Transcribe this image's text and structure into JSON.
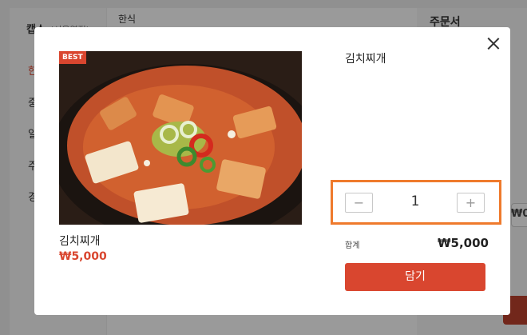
{
  "background": {
    "brand": "캡스",
    "brand_sub": "(서울역점)",
    "sidebar_items": [
      "한",
      "중",
      "일",
      "주",
      "경"
    ],
    "main_title": "한식",
    "order_title": "주문서",
    "order_amount_partial": "₩0"
  },
  "modal": {
    "badge": "BEST",
    "photo_label": "kimchi-stew-photo",
    "item_name": "김치찌개",
    "item_price": "₩5,000",
    "detail_name": "김치찌개",
    "quantity": {
      "minus": "−",
      "value": "1",
      "plus": "+"
    },
    "total_label": "합계",
    "total_value": "₩5,000",
    "add_button": "담기",
    "close_icon": "close-icon"
  },
  "colors": {
    "accent": "#d9462f",
    "highlight": "#ef7a2c"
  }
}
